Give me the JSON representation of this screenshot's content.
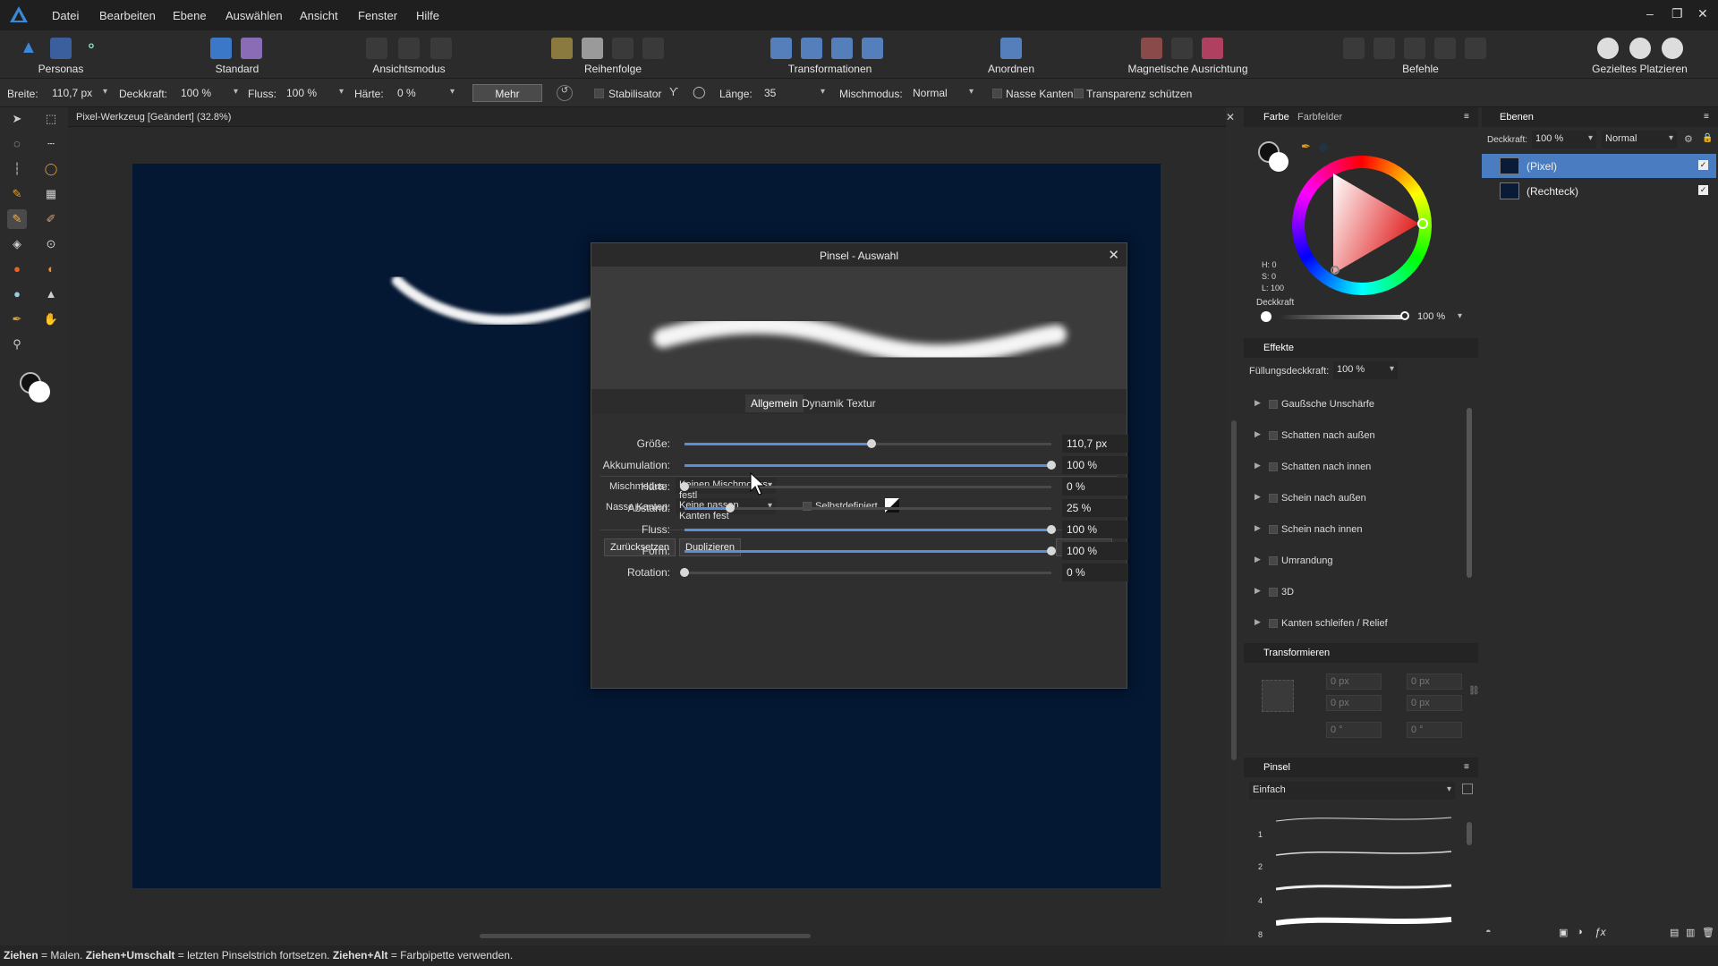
{
  "menu": {
    "items": [
      "Datei",
      "Bearbeiten",
      "Ebene",
      "Auswählen",
      "Ansicht",
      "Fenster",
      "Hilfe"
    ]
  },
  "toolbar": {
    "groups": [
      {
        "label": "Personas"
      },
      {
        "label": "Standard"
      },
      {
        "label": "Ansichtsmodus"
      },
      {
        "label": "Reihenfolge"
      },
      {
        "label": "Transformationen"
      },
      {
        "label": "Anordnen"
      },
      {
        "label": "Magnetische Ausrichtung"
      },
      {
        "label": "Befehle"
      },
      {
        "label": "Gezieltes Platzieren"
      }
    ]
  },
  "context": {
    "breite_label": "Breite:",
    "breite_value": "110,7 px",
    "deckkraft_label": "Deckkraft:",
    "deckkraft_value": "100 %",
    "fluss_label": "Fluss:",
    "fluss_value": "100 %",
    "haerte_label": "Härte:",
    "haerte_value": "0 %",
    "mehr": "Mehr",
    "stabilisator": "Stabilisator",
    "laenge_label": "Länge:",
    "laenge_value": "35",
    "mischmodus_label": "Mischmodus:",
    "mischmodus_value": "Normal",
    "nasse_kanten": "Nasse Kanten",
    "transparenz": "Transparenz schützen"
  },
  "document": {
    "tab_title": "Pixel-Werkzeug [Geändert] (32.8%)"
  },
  "dialog": {
    "title": "Pinsel - Auswahl",
    "tabs": [
      "Allgemein",
      "Dynamik",
      "Textur"
    ],
    "active_tab": "Allgemein",
    "params": [
      {
        "label": "Größe:",
        "value": "110,7 px",
        "fraction": 0.51
      },
      {
        "label": "Akkumulation:",
        "value": "100 %",
        "fraction": 1.0
      },
      {
        "label": "Härte:",
        "value": "0 %",
        "fraction": 0.0
      },
      {
        "label": "Abstand:",
        "value": "25 %",
        "fraction": 0.125
      },
      {
        "label": "Fluss:",
        "value": "100 %",
        "fraction": 1.0
      },
      {
        "label": "Form:",
        "value": "100 %",
        "fraction": 1.0
      },
      {
        "label": "Rotation:",
        "value": "0 %",
        "fraction": 0.0
      }
    ],
    "mischmodus_label": "Mischmodus:",
    "mischmodus_value": "Keinen Mischmodus festl",
    "nasse_label": "Nasse Kanten:",
    "nasse_value": "Keine nassen Kanten fest",
    "selbst": "Selbstdefiniert",
    "reset": "Zurücksetzen",
    "duplicate": "Duplizieren",
    "close": "Schließen"
  },
  "color_panel": {
    "tab_farbe": "Farbe",
    "tab_farbfelder": "Farbfelder",
    "h": "H: 0",
    "s": "S: 0",
    "l": "L: 100",
    "deckkraft_label": "Deckkraft",
    "deckkraft_value": "100 %",
    "deckkraft_fraction": 1.0
  },
  "effects_panel": {
    "title": "Effekte",
    "fuellung_label": "Füllungsdeckkraft:",
    "fuellung_value": "100 %",
    "items": [
      "Gaußsche Unschärfe",
      "Schatten nach außen",
      "Schatten nach innen",
      "Schein nach außen",
      "Schein nach innen",
      "Umrandung",
      "3D",
      "Kanten schleifen / Relief"
    ]
  },
  "transform_panel": {
    "title": "Transformieren",
    "x": "0 px",
    "y": "0 px",
    "w": "0 px",
    "h": "0 px",
    "r": "0 °",
    "s": "0 °"
  },
  "brush_panel": {
    "title": "Pinsel",
    "category": "Einfach",
    "sizes": [
      "1",
      "2",
      "4",
      "8"
    ]
  },
  "layers_panel": {
    "title": "Ebenen",
    "deckkraft_label": "Deckkraft:",
    "deckkraft_value": "100 %",
    "blend": "Normal",
    "layers": [
      {
        "name": "(Pixel)",
        "selected": true
      },
      {
        "name": "(Rechteck)",
        "selected": false
      }
    ]
  },
  "status": {
    "b1": "Ziehen",
    "t1": " = Malen. ",
    "b2": "Ziehen+Umschalt",
    "t2": " = letzten Pinselstrich fortsetzen. ",
    "b3": "Ziehen+Alt",
    "t3": " = Farbpipette verwenden."
  },
  "colors": {
    "accent": "#5c8fd6",
    "canvas": "#041733",
    "selected_layer": "#4a7cc2"
  }
}
